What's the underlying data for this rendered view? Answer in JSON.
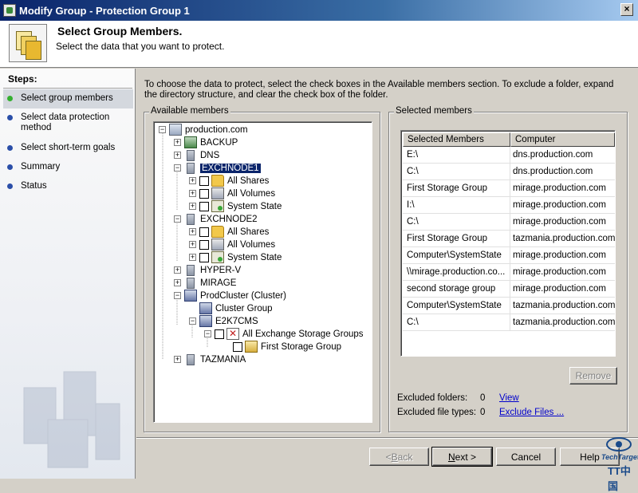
{
  "window": {
    "title": "Modify Group - Protection Group 1",
    "close_glyph": "×"
  },
  "header": {
    "title": "Select Group Members.",
    "subtitle": "Select the data that you want to protect."
  },
  "steps": {
    "label": "Steps:",
    "items": [
      {
        "label": "Select group members",
        "active": true
      },
      {
        "label": "Select data protection method",
        "active": false
      },
      {
        "label": "Select short-term goals",
        "active": false
      },
      {
        "label": "Summary",
        "active": false
      },
      {
        "label": "Status",
        "active": false
      }
    ]
  },
  "instruction": "To choose the data to protect, select the check boxes in the Available members section. To exclude a folder, expand the directory structure, and clear the check box of the folder.",
  "available": {
    "legend": "Available members",
    "tree": [
      {
        "label": "production.com",
        "icon": "domain-icon",
        "expander": "−"
      },
      {
        "label": "BACKUP",
        "icon": "backup-server-icon",
        "expander": "+"
      },
      {
        "label": "DNS",
        "icon": "server-icon",
        "expander": "+"
      },
      {
        "label": "EXCHNODE1",
        "icon": "server-icon",
        "expander": "−",
        "selected": true
      },
      {
        "label": "All Shares",
        "icon": "shared-folder-icon",
        "expander": "+"
      },
      {
        "label": "All Volumes",
        "icon": "volume-icon",
        "expander": "+"
      },
      {
        "label": "System State",
        "icon": "system-state-icon",
        "expander": "+"
      },
      {
        "label": "EXCHNODE2",
        "icon": "server-icon",
        "expander": "−"
      },
      {
        "label": "All Shares",
        "icon": "shared-folder-icon",
        "expander": "+"
      },
      {
        "label": "All Volumes",
        "icon": "volume-icon",
        "expander": "+"
      },
      {
        "label": "System State",
        "icon": "system-state-icon",
        "expander": "+"
      },
      {
        "label": "HYPER-V",
        "icon": "server-icon",
        "expander": "+"
      },
      {
        "label": "MIRAGE",
        "icon": "server-icon",
        "expander": "+"
      },
      {
        "label": "ProdCluster (Cluster)",
        "icon": "cluster-icon",
        "expander": "−"
      },
      {
        "label": "Cluster Group",
        "icon": "cluster-group-icon"
      },
      {
        "label": "E2K7CMS",
        "icon": "cluster-group-icon",
        "expander": "−"
      },
      {
        "label": "All Exchange Storage Groups",
        "icon": "exchange-icon",
        "expander": "−"
      },
      {
        "label": "First Storage Group",
        "icon": "storage-group-icon"
      },
      {
        "label": "TAZMANIA",
        "icon": "server-icon",
        "expander": "+"
      }
    ]
  },
  "selected": {
    "legend": "Selected members",
    "columns": [
      "Selected Members",
      "Computer"
    ],
    "rows": [
      [
        "E:\\",
        "dns.production.com"
      ],
      [
        "C:\\",
        "dns.production.com"
      ],
      [
        "First Storage Group",
        "mirage.production.com"
      ],
      [
        "I:\\",
        "mirage.production.com"
      ],
      [
        "C:\\",
        "mirage.production.com"
      ],
      [
        "First Storage Group",
        "tazmania.production.com"
      ],
      [
        "Computer\\SystemState",
        "mirage.production.com"
      ],
      [
        "\\\\mirage.production.co...",
        "mirage.production.com"
      ],
      [
        "second storage group",
        "mirage.production.com"
      ],
      [
        "Computer\\SystemState",
        "tazmania.production.com"
      ],
      [
        "C:\\",
        "tazmania.production.com"
      ]
    ],
    "remove_label": "Remove",
    "excluded_folders_label": "Excluded folders:",
    "excluded_folders_count": "0",
    "view_link": "View",
    "excluded_types_label": "Excluded file types:",
    "excluded_types_count": "0",
    "exclude_files_link": "Exclude Files ..."
  },
  "buttons": {
    "back_prefix": "< ",
    "back_key": "B",
    "back_rest": "ack",
    "next_key": "N",
    "next_rest": "ext >",
    "cancel": "Cancel",
    "help": "Help"
  },
  "brand": {
    "line1": "TechTarget",
    "line2": "TT中国"
  }
}
